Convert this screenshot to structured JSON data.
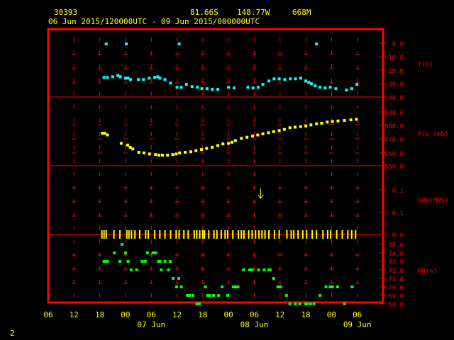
{
  "header": {
    "station": "30393",
    "lat": "81.66S",
    "lon": "148.77W",
    "elev": "668M",
    "range": "06 Jun 2015/120000UTC - 09 Jun 2015/000000UTC"
  },
  "footer": {
    "page": "2"
  },
  "colors": {
    "frame": "#ff0000",
    "text": "#ffff00",
    "temp": "#00ffff",
    "pres": "#ffff00",
    "rh": "#00ff00"
  },
  "chart_data": {
    "type": "scatter",
    "x_unit": "hours from 06 Jun 00 UTC",
    "x_ticks": {
      "values": [
        0,
        6,
        12,
        18,
        24,
        30,
        36,
        42,
        48,
        54,
        60,
        66,
        72,
        78
      ],
      "labels": [
        "06",
        "12",
        "18",
        "00",
        "06",
        "12",
        "18",
        "00",
        "06",
        "12",
        "18",
        "00",
        "06"
      ]
    },
    "x_date_labels": [
      {
        "x": 24,
        "label": "07 Jun"
      },
      {
        "x": 48,
        "label": "08 Jun"
      },
      {
        "x": 72,
        "label": "09 Jun"
      }
    ],
    "panels": [
      {
        "label": "T(C)",
        "ylim": [
          -40,
          0
        ],
        "ticks": [
          "0.0",
          "-10.0",
          "-20.0",
          "-30.0",
          "-40.0"
        ],
        "tick_values": [
          0,
          -10,
          -20,
          -30,
          -40
        ],
        "x": [
          13,
          13.8,
          15,
          16.2,
          16.8,
          18,
          18.6,
          19.2,
          21,
          22.2,
          23.5,
          24.8,
          25.5,
          26,
          27.2,
          28.5,
          30,
          31,
          32.2,
          33.5,
          34.7,
          35.8,
          37,
          38.2,
          39.5,
          42,
          43.3,
          46.5,
          47.7,
          48.9,
          50,
          51.4,
          52.6,
          53.8,
          55.1,
          56.4,
          57.6,
          58.8,
          60,
          60.7,
          61.3,
          62.2,
          63.3,
          64.5,
          65.7,
          67,
          69.5,
          70.7,
          71.9
        ],
        "y": [
          -26,
          -26,
          -25.5,
          -24.5,
          -25.5,
          -26.5,
          -26.5,
          -27.5,
          -27.5,
          -27.5,
          -26.5,
          -26,
          -25.5,
          -26.5,
          -27.5,
          -30,
          -33,
          -33,
          -31,
          -32.5,
          -33,
          -34,
          -34,
          -34.5,
          -34.5,
          -33,
          -33.5,
          -33,
          -33.5,
          -33,
          -31,
          -28.5,
          -27,
          -27,
          -27.5,
          -27,
          -27,
          -26.5,
          -28.5,
          -29.5,
          -30.5,
          -32,
          -33,
          -33.5,
          -33,
          -34,
          -35,
          -34,
          -31
        ]
      },
      {
        "label": "Pre (mb)",
        "ylim": [
          850,
          900
        ],
        "ticks": [
          "890.0",
          "880.0",
          "870.0",
          "860.0",
          "850.0"
        ],
        "tick_values": [
          890,
          880,
          870,
          860,
          850
        ],
        "x": [
          12.6,
          13.2,
          13.8,
          17,
          18.5,
          19.1,
          19.7,
          21.1,
          22.3,
          23.6,
          25,
          25.8,
          26.6,
          27.8,
          29,
          29.8,
          30.6,
          31.9,
          33.2,
          34.4,
          35.7,
          36.9,
          38.2,
          39.5,
          40.7,
          42,
          42.8,
          43.6,
          45,
          46.3,
          47.6,
          48.8,
          50,
          51.3,
          52.5,
          53.8,
          55,
          56.3,
          57.5,
          58.8,
          60,
          61.2,
          62.5,
          63.7,
          65,
          66.2,
          67.5,
          69,
          70.5,
          71.8
        ],
        "y": [
          879,
          879,
          877.5,
          870,
          868.5,
          866.5,
          865,
          862,
          861.5,
          860.5,
          860,
          859.5,
          859.5,
          859.5,
          860,
          860.5,
          861.5,
          862,
          862.5,
          863.5,
          864.5,
          865.5,
          866.5,
          868,
          869.5,
          870,
          871,
          872.5,
          874.5,
          875.5,
          876.5,
          877.5,
          878.5,
          879.5,
          880.5,
          881.5,
          882.5,
          884,
          884.5,
          885,
          885.5,
          886.5,
          887.5,
          888,
          889,
          889.5,
          890,
          890.5,
          891,
          891.5
        ]
      },
      {
        "label": "SPD(MPS)",
        "ticks": [
          "0.1",
          "0.1",
          "0.0"
        ],
        "wind_barbs": [
          {
            "x": 49.5,
            "y": 0.25,
            "dir": "S"
          }
        ],
        "obs_ticks_x": [
          12.5,
          13,
          13.5,
          15.3,
          16.7,
          18.3,
          18.8,
          19.4,
          20.2,
          21.3,
          22.7,
          23.3,
          24.8,
          26,
          27.2,
          28.5,
          29.8,
          30.5,
          31.6,
          32.6,
          34,
          34.6,
          35.3,
          36,
          36.4,
          37.4,
          38.6,
          39.3,
          40.3,
          41.2,
          41.8,
          43,
          44.3,
          45,
          45.6,
          46.7,
          47.5,
          48.3,
          49.1,
          49.8,
          50.5,
          51.4,
          52.7,
          53.8,
          55.6,
          56.6,
          57.2,
          58.2,
          59.3,
          60.2,
          61.5,
          62.5,
          64,
          65.1,
          65.8,
          67.2,
          68.5,
          69.8,
          70.7,
          71.6
        ]
      },
      {
        "label": "RH(%)",
        "ylim": [
          68,
          75
        ],
        "ticks": [
          "75.0",
          "74.0",
          "73.0",
          "72.0",
          "71.0",
          "70.0",
          "69.0",
          "68.0"
        ],
        "tick_values": [
          75,
          74,
          73,
          72,
          71,
          70,
          69,
          68
        ],
        "x": [
          13,
          13.2,
          13.8,
          15.4,
          16.7,
          17.2,
          18,
          18.6,
          19.3,
          20.6,
          21.9,
          22.6,
          23.1,
          24.4,
          25,
          25.7,
          26,
          26.3,
          27.2,
          28,
          28.4,
          29.1,
          29.9,
          30.4,
          31,
          32.4,
          32.9,
          33.7,
          34.6,
          35.2,
          36.6,
          37.1,
          37.6,
          38.5,
          39.7,
          40.5,
          41.8,
          43.1,
          43.6,
          44.2,
          45.5,
          46.9,
          47.5,
          49,
          50.3,
          51.4,
          51.7,
          52.5,
          53.5,
          54.1,
          55.5,
          56.3,
          57.6,
          58.6,
          60,
          60.3,
          61.1,
          61.9,
          63.3,
          64.7,
          65.7,
          66.2,
          67.4,
          69,
          70.8
        ],
        "y": [
          73,
          73,
          73,
          74,
          73,
          75,
          74,
          73,
          72,
          72,
          73,
          73,
          74,
          74,
          74,
          73,
          73,
          72,
          73,
          72,
          73,
          71,
          70,
          71,
          70,
          69,
          69,
          69,
          68,
          68,
          70,
          69,
          69,
          69,
          69,
          70,
          69,
          70,
          70,
          70,
          72,
          72,
          72,
          72,
          72,
          72,
          72,
          71,
          70,
          70,
          69,
          68,
          68,
          68,
          68,
          68,
          68,
          68,
          69,
          70,
          70,
          70,
          70,
          68,
          70
        ]
      }
    ]
  }
}
